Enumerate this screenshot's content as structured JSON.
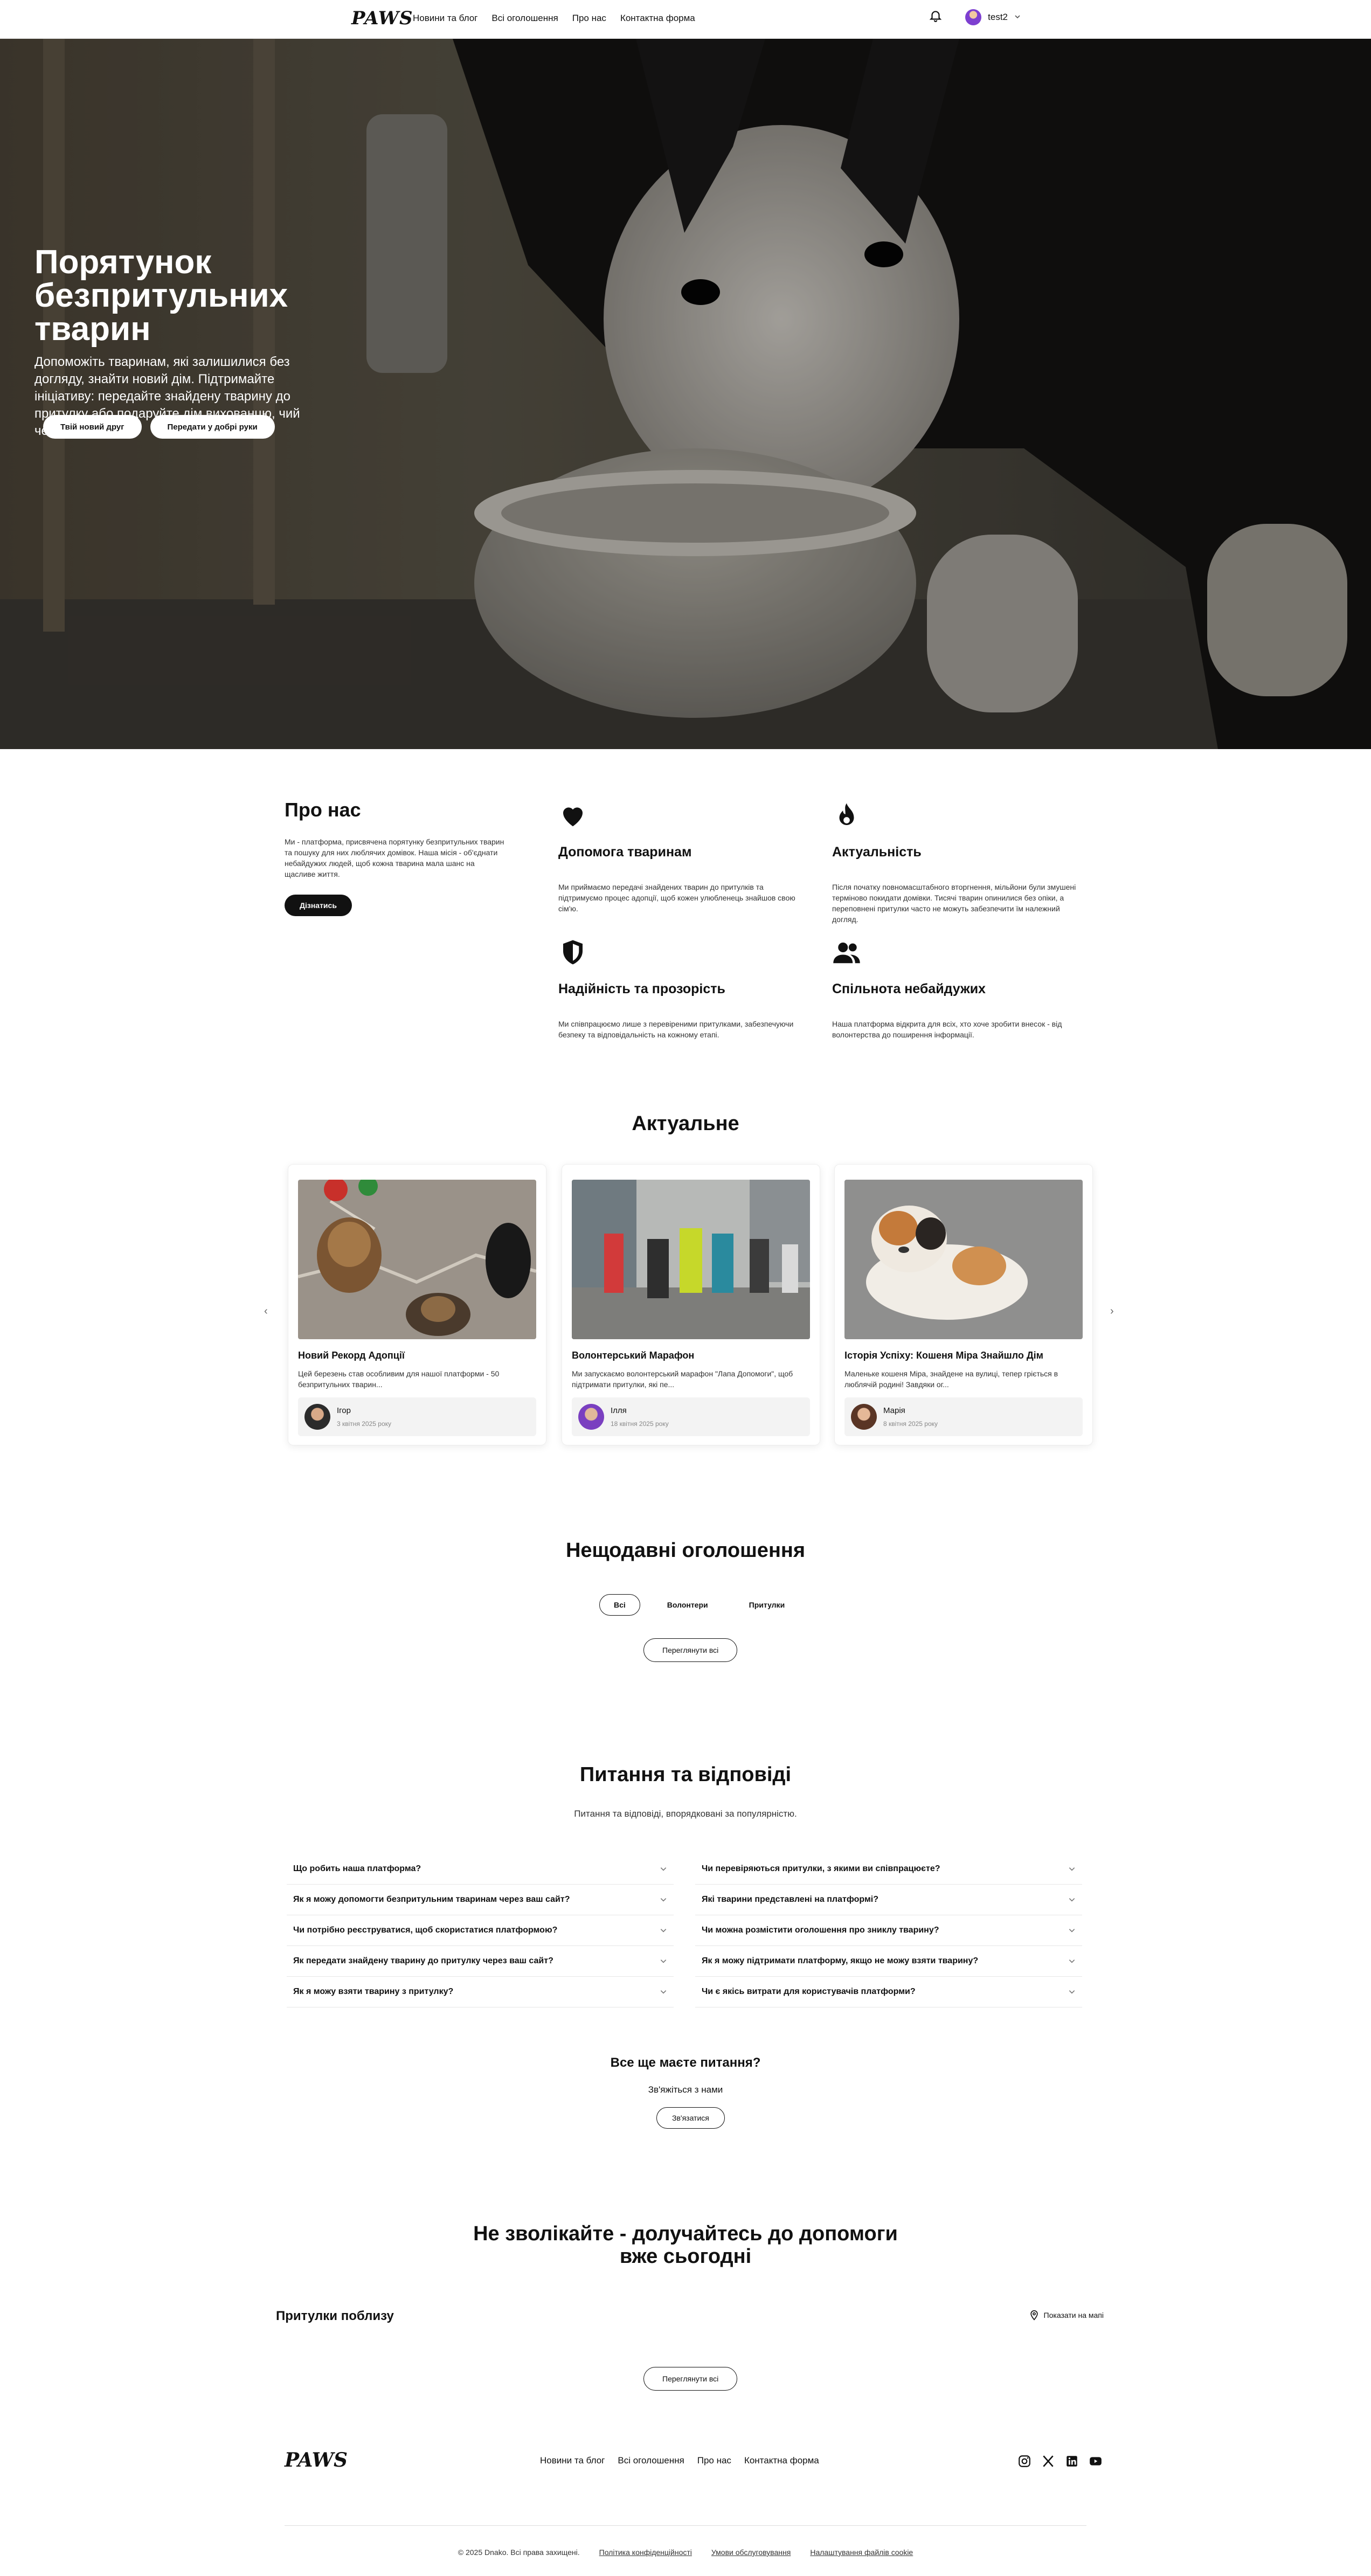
{
  "nav": {
    "logo": "PAWS",
    "links": [
      "Новини та блог",
      "Всі оголошення",
      "Про нас",
      "Контактна форма"
    ],
    "user": "test2"
  },
  "hero": {
    "title": "Порятунок безпритульних тварин",
    "subtitle": "Допоможіть тваринам, які залишилися без догляду, знайти новий дім. Підтримайте ініціативу: передайте знайдену тварину до притулку або подаруйте дім вихованцю, чий чекає на вас.",
    "btn_primary": "Твій новий друг",
    "btn_secondary": "Передати у добрі руки"
  },
  "about": {
    "title": "Про нас",
    "text": "Ми - платформа, присвячена порятунку безпритульних тварин та пошуку для них люблячих домівок. Наша місія - об'єднати небайдужих людей, щоб кожна тварина мала шанс на щасливе життя.",
    "button": "Дізнатись",
    "features": [
      {
        "icon": "heart-icon",
        "title": "Допомога тваринам",
        "desc": "Ми приймаємо передачі знайдених тварин до притулків та підтримуємо процес адопції, щоб кожен улюбленець знайшов свою сім'ю."
      },
      {
        "icon": "fire-icon",
        "title": "Актуальність",
        "desc": "Після початку повномасштабного вторгнення, мільйони були змушені терміново покидати домівки. Тисячі тварин опинилися без опіки, а переповнені притулки часто не можуть забезпечити їм належний догляд."
      },
      {
        "icon": "shield-icon",
        "title": "Надійність та прозорість",
        "desc": "Ми співпрацюємо лише з перевіреними притулками, забезпечуючи безпеку та відповідальність на кожному етапі."
      },
      {
        "icon": "users-icon",
        "title": "Спільнота небайдужих",
        "desc": "Наша платформа відкрита для всіх, хто хоче зробити внесок - від волонтерства до поширення інформації."
      }
    ]
  },
  "current": {
    "title": "Актуальне",
    "cards": [
      {
        "title": "Новий Рекорд Адопції",
        "desc": "Цей березень став особливим для нашої платформи - 50 безпритульних тварин...",
        "author": "Ігор",
        "date": "3 квітня 2025 року"
      },
      {
        "title": "Волонтерський Марафон",
        "desc": "Ми запускаємо волонтерський марафон \"Лапа Допомоги\", щоб підтримати притулки, які пе...",
        "author": "Ілля",
        "date": "18 квітня 2025 року"
      },
      {
        "title": "Історія Успіху: Кошеня Міра Знайшло Дім",
        "desc": "Маленьке кошеня Міра, знайдене на вулиці, тепер гріється в люблячій родині! Завдяки ог...",
        "author": "Марія",
        "date": "8 квітня 2025 року"
      }
    ]
  },
  "announcements": {
    "title": "Нещодавні оголошення",
    "tabs": [
      "Всі",
      "Волонтери",
      "Притулки"
    ],
    "view_all": "Переглянути всі"
  },
  "faq": {
    "title": "Питання та відповіді",
    "subtitle": "Питання та відповіді, впорядковані за популярністю.",
    "left": [
      "Що робить наша платформа?",
      "Як я можу допомогти безпритульним тваринам через ваш сайт?",
      "Чи потрібно реєструватися, щоб скористатися платформою?",
      "Як передати знайдену тварину до притулку через ваш сайт?",
      "Як я можу взяти тварину з притулку?"
    ],
    "right": [
      "Чи перевіряються притулки, з якими ви співпрацюєте?",
      "Які тварини представлені на платформі?",
      "Чи можна розмістити оголошення про зниклу тварину?",
      "Як я можу підтримати платформу, якщо не можу взяти тварину?",
      "Чи є якісь витрати для користувачів платформи?"
    ],
    "still_title": "Все ще маєте питання?",
    "still_sub": "Зв'яжіться з нами",
    "contact_btn": "Зв'язатися"
  },
  "cta": {
    "title": "Не зволікайте - долучайтесь до допомоги вже сьогодні",
    "nearby": "Притулки поблизу",
    "map_link": "Показати на мапі",
    "view_all": "Переглянути всі"
  },
  "footer": {
    "logo": "PAWS",
    "links": [
      "Новини та блог",
      "Всі оголошення",
      "Про нас",
      "Контактна форма"
    ],
    "copyright": "© 2025 Dnako. Всі права захищені.",
    "policy": "Політика конфіденційності",
    "terms": "Умови обслуговування",
    "cookies": "Налаштування файлів cookie"
  }
}
